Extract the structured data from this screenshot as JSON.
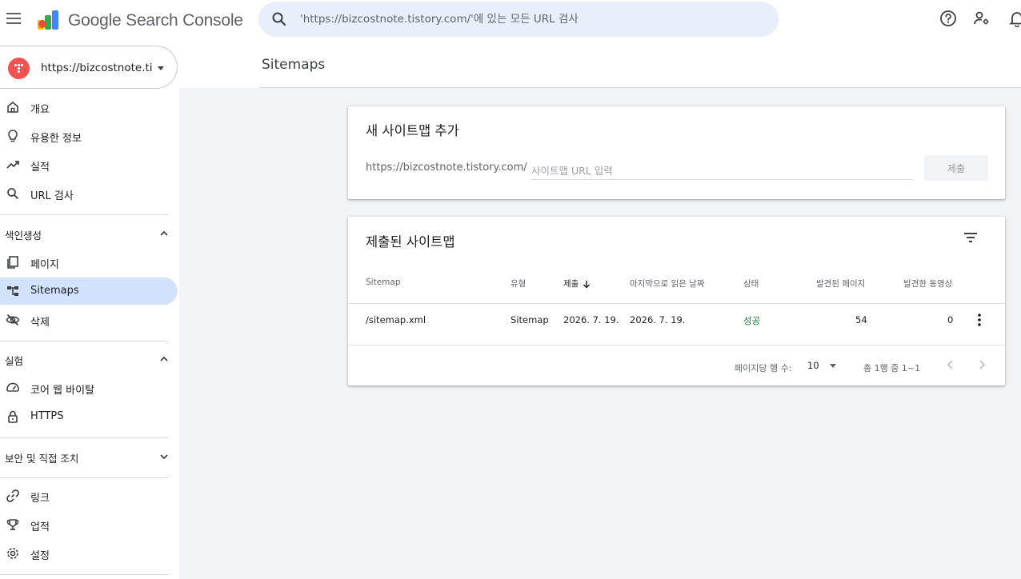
{
  "header": {
    "brand": "Google Search Console",
    "search_placeholder": "'https://bizcostnote.tistory.com/'에 있는 모든 URL 검사"
  },
  "sidebar": {
    "property": "https://bizcostnote.tis...",
    "items_top": [
      {
        "label": "개요",
        "icon": "home-icon"
      },
      {
        "label": "유용한 정보",
        "icon": "lightbulb-icon"
      },
      {
        "label": "실적",
        "icon": "trending-up-icon"
      },
      {
        "label": "URL 검사",
        "icon": "search-icon"
      }
    ],
    "section_indexing": {
      "label": "색인생성",
      "state": "expanded"
    },
    "items_indexing": [
      {
        "label": "페이지",
        "icon": "pages-icon"
      },
      {
        "label": "Sitemaps",
        "icon": "sitemap-icon",
        "active": true
      },
      {
        "label": "삭제",
        "icon": "visibility-off-icon"
      }
    ],
    "section_experience": {
      "label": "실험",
      "state": "expanded"
    },
    "items_experience": [
      {
        "label": "코어 웹 바이탈",
        "icon": "speed-icon"
      },
      {
        "label": "HTTPS",
        "icon": "lock-icon"
      }
    ],
    "section_security": {
      "label": "보안 및 직접 조치",
      "state": "collapsed"
    },
    "items_bottom": [
      {
        "label": "링크",
        "icon": "link-icon"
      },
      {
        "label": "업적",
        "icon": "trophy-icon"
      },
      {
        "label": "설정",
        "icon": "settings-icon"
      }
    ]
  },
  "main": {
    "page_title": "Sitemaps",
    "add_card": {
      "title": "새 사이트맵 추가",
      "prefix": "https://bizcostnote.tistory.com/",
      "input_placeholder": "사이트맵 URL 입력",
      "submit_label": "제출"
    },
    "submitted_card": {
      "title": "제출된 사이트맵",
      "columns": [
        "Sitemap",
        "유형",
        "제출",
        "마지막으로 읽은 날짜",
        "상태",
        "발견된 페이지",
        "발견한 동영상"
      ],
      "sorted_column": "제출",
      "rows": [
        {
          "sitemap": "/sitemap.xml",
          "type": "Sitemap",
          "submitted": "2026. 7. 19.",
          "last_read": "2026. 7. 19.",
          "status": "성공",
          "pages": "54",
          "videos": "0"
        }
      ],
      "pager": {
        "rows_label": "페이지당 행 수:",
        "rows_value": "10",
        "range": "총 1행 중 1~1"
      }
    }
  },
  "colors": {
    "accent_active": "#d3e3fd",
    "status_success": "#188038",
    "search_bg": "#e8effa"
  }
}
